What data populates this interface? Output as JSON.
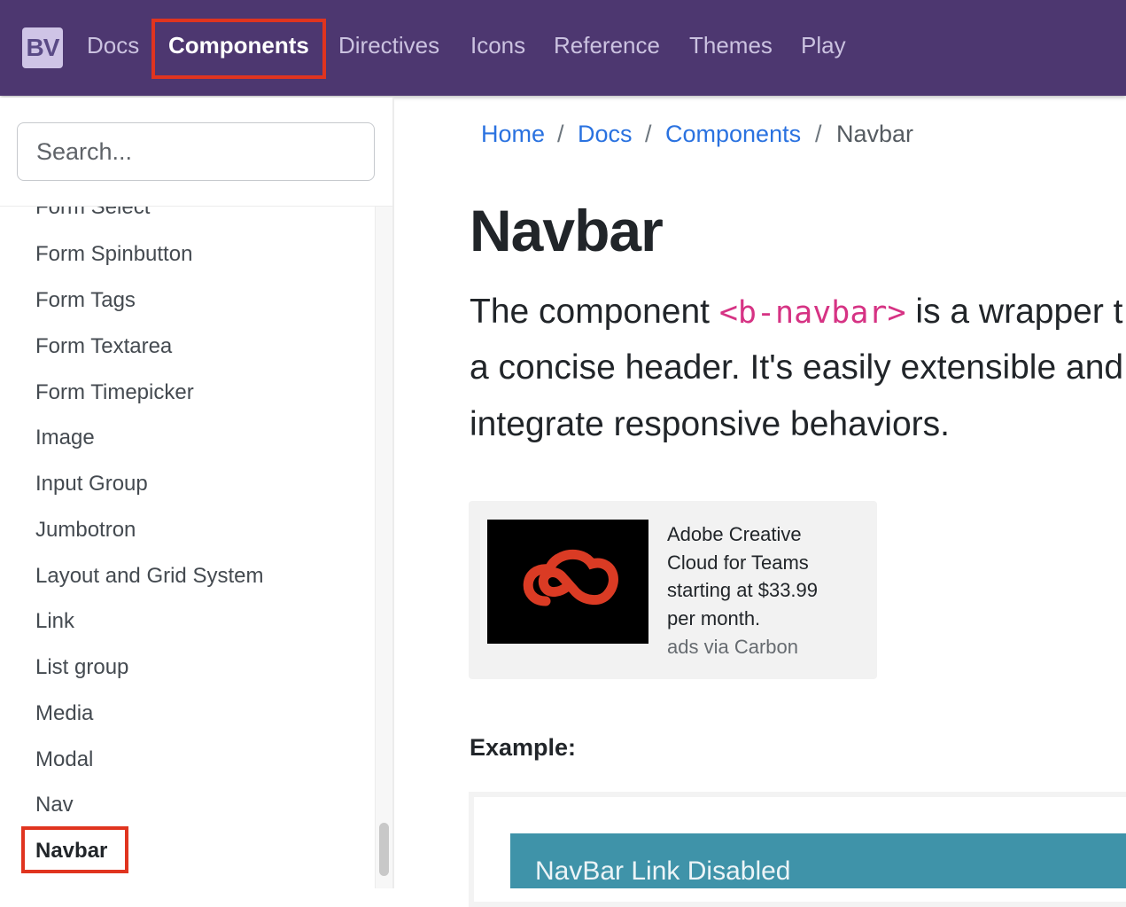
{
  "topnav": {
    "logo": "BV",
    "links": [
      "Docs",
      "Components",
      "Directives",
      "Icons",
      "Reference",
      "Themes",
      "Play"
    ],
    "active_index": 1
  },
  "sidebar": {
    "search_placeholder": "Search...",
    "items": [
      "Form Select",
      "Form Spinbutton",
      "Form Tags",
      "Form Textarea",
      "Form Timepicker",
      "Image",
      "Input Group",
      "Jumbotron",
      "Layout and Grid System",
      "Link",
      "List group",
      "Media",
      "Modal",
      "Nav",
      "Navbar"
    ],
    "active_item": "Navbar"
  },
  "breadcrumb": {
    "items": [
      "Home",
      "Docs",
      "Components",
      "Navbar"
    ],
    "separator": "/"
  },
  "main": {
    "title": "Navbar",
    "lead_pre": "The component ",
    "lead_code": "<b-navbar>",
    "lead_post": " is a wrapper t",
    "lead_line2": "a concise header. It's easily extensible and",
    "lead_line3": "integrate responsive behaviors.",
    "example_label": "Example:",
    "example_brand": "NavBar   Link   Disabled"
  },
  "ad": {
    "lines": [
      "Adobe Creative",
      "Cloud for Teams",
      "starting at $33.99",
      "per month."
    ],
    "via": "ads via Carbon",
    "icon": "adobe-creative-cloud-icon"
  },
  "colors": {
    "navbar_bg": "#4d3770",
    "highlight": "#e0341f",
    "link": "#2a72e0",
    "code": "#d63384"
  }
}
